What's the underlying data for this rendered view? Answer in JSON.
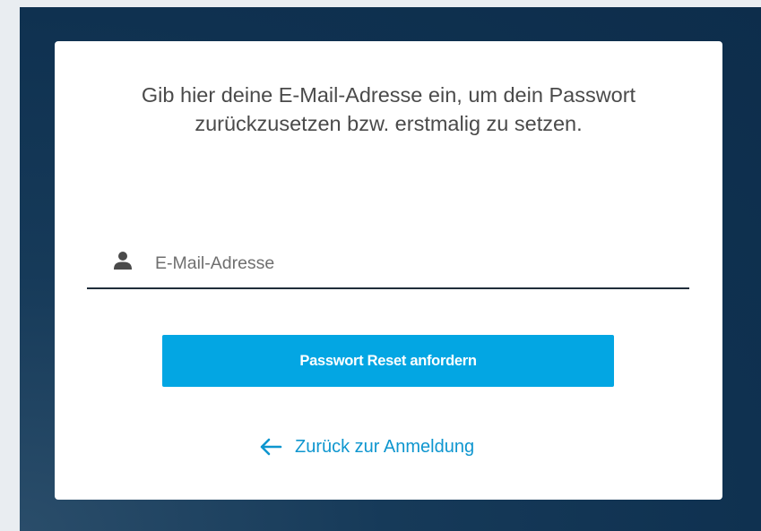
{
  "reset_form": {
    "instruction": "Gib hier deine E-Mail-Adresse ein, um dein Passwort zurückzusetzen bzw. erstmalig zu setzen.",
    "email_field": {
      "placeholder": "E-Mail-Adresse",
      "value": "",
      "icon": "person-icon"
    },
    "submit_label": "Passwort Reset anfordern",
    "back_link": {
      "label": "Zurück zur Anmeldung",
      "icon": "arrow-left-icon"
    }
  },
  "colors": {
    "background": "#0f3150",
    "card": "#ffffff",
    "primary_button": "#03a6e3",
    "link": "#0e96cf",
    "text": "#4a4a4a"
  }
}
